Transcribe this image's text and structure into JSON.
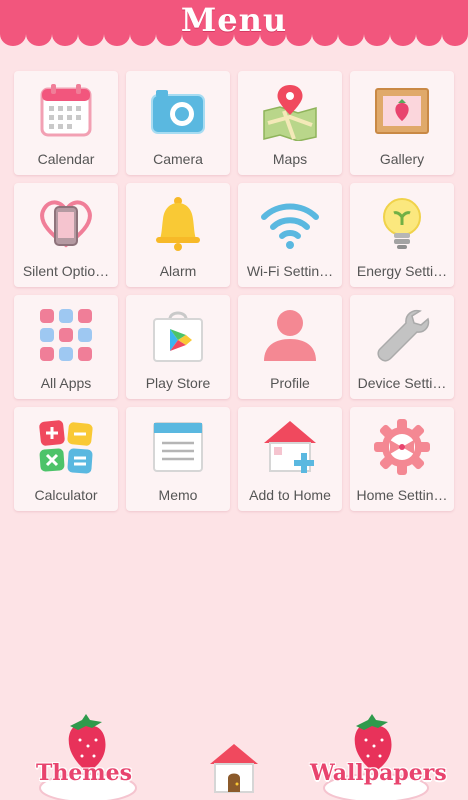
{
  "header": {
    "title": "Menu"
  },
  "apps": [
    {
      "label": "Calendar",
      "icon": "calendar-icon"
    },
    {
      "label": "Camera",
      "icon": "camera-icon"
    },
    {
      "label": "Maps",
      "icon": "map-icon"
    },
    {
      "label": "Gallery",
      "icon": "picture-frame-icon"
    },
    {
      "label": "Silent Optio…",
      "icon": "phone-heart-icon"
    },
    {
      "label": "Alarm",
      "icon": "bell-icon"
    },
    {
      "label": "Wi-Fi Settin…",
      "icon": "wifi-icon"
    },
    {
      "label": "Energy Setti…",
      "icon": "lightbulb-icon"
    },
    {
      "label": "All Apps",
      "icon": "app-grid-icon"
    },
    {
      "label": "Play Store",
      "icon": "play-store-bag-icon"
    },
    {
      "label": "Profile",
      "icon": "person-icon"
    },
    {
      "label": "Device Setti…",
      "icon": "wrench-icon"
    },
    {
      "label": "Calculator",
      "icon": "calculator-icon"
    },
    {
      "label": "Memo",
      "icon": "memo-icon"
    },
    {
      "label": "Add to Home",
      "icon": "house-plus-icon"
    },
    {
      "label": "Home Settin…",
      "icon": "gear-bow-icon"
    }
  ],
  "dock": {
    "themes_label": "Themes",
    "wallpapers_label": "Wallpapers"
  },
  "colors": {
    "accent": "#f2567d",
    "background": "#fde3e6",
    "tile": "#fdf3f4"
  }
}
